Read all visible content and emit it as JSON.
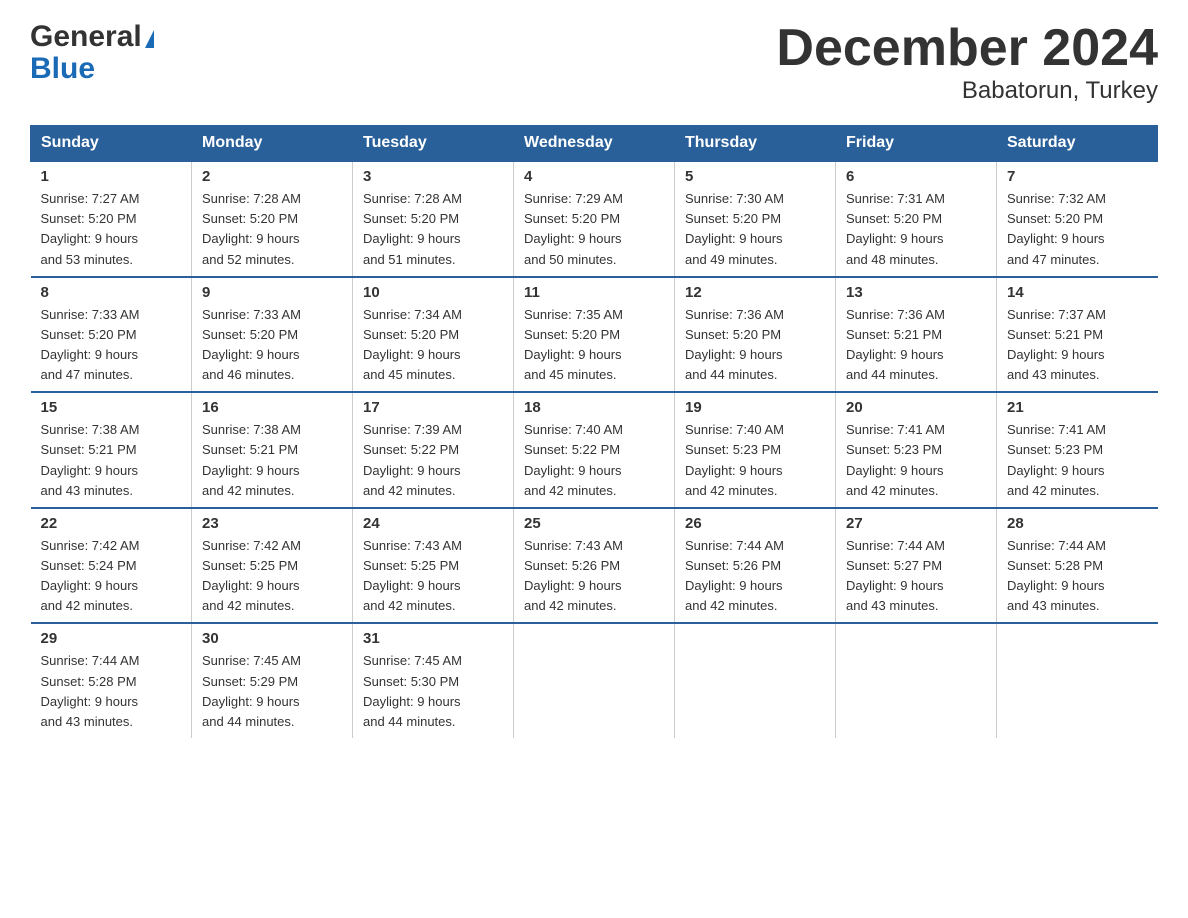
{
  "logo": {
    "line1": "General",
    "triangle": "▶",
    "line2": "Blue"
  },
  "title": "December 2024",
  "subtitle": "Babatorun, Turkey",
  "days_header": [
    "Sunday",
    "Monday",
    "Tuesday",
    "Wednesday",
    "Thursday",
    "Friday",
    "Saturday"
  ],
  "weeks": [
    [
      {
        "day": "1",
        "sunrise": "7:27 AM",
        "sunset": "5:20 PM",
        "daylight": "9 hours and 53 minutes."
      },
      {
        "day": "2",
        "sunrise": "7:28 AM",
        "sunset": "5:20 PM",
        "daylight": "9 hours and 52 minutes."
      },
      {
        "day": "3",
        "sunrise": "7:28 AM",
        "sunset": "5:20 PM",
        "daylight": "9 hours and 51 minutes."
      },
      {
        "day": "4",
        "sunrise": "7:29 AM",
        "sunset": "5:20 PM",
        "daylight": "9 hours and 50 minutes."
      },
      {
        "day": "5",
        "sunrise": "7:30 AM",
        "sunset": "5:20 PM",
        "daylight": "9 hours and 49 minutes."
      },
      {
        "day": "6",
        "sunrise": "7:31 AM",
        "sunset": "5:20 PM",
        "daylight": "9 hours and 48 minutes."
      },
      {
        "day": "7",
        "sunrise": "7:32 AM",
        "sunset": "5:20 PM",
        "daylight": "9 hours and 47 minutes."
      }
    ],
    [
      {
        "day": "8",
        "sunrise": "7:33 AM",
        "sunset": "5:20 PM",
        "daylight": "9 hours and 47 minutes."
      },
      {
        "day": "9",
        "sunrise": "7:33 AM",
        "sunset": "5:20 PM",
        "daylight": "9 hours and 46 minutes."
      },
      {
        "day": "10",
        "sunrise": "7:34 AM",
        "sunset": "5:20 PM",
        "daylight": "9 hours and 45 minutes."
      },
      {
        "day": "11",
        "sunrise": "7:35 AM",
        "sunset": "5:20 PM",
        "daylight": "9 hours and 45 minutes."
      },
      {
        "day": "12",
        "sunrise": "7:36 AM",
        "sunset": "5:20 PM",
        "daylight": "9 hours and 44 minutes."
      },
      {
        "day": "13",
        "sunrise": "7:36 AM",
        "sunset": "5:21 PM",
        "daylight": "9 hours and 44 minutes."
      },
      {
        "day": "14",
        "sunrise": "7:37 AM",
        "sunset": "5:21 PM",
        "daylight": "9 hours and 43 minutes."
      }
    ],
    [
      {
        "day": "15",
        "sunrise": "7:38 AM",
        "sunset": "5:21 PM",
        "daylight": "9 hours and 43 minutes."
      },
      {
        "day": "16",
        "sunrise": "7:38 AM",
        "sunset": "5:21 PM",
        "daylight": "9 hours and 42 minutes."
      },
      {
        "day": "17",
        "sunrise": "7:39 AM",
        "sunset": "5:22 PM",
        "daylight": "9 hours and 42 minutes."
      },
      {
        "day": "18",
        "sunrise": "7:40 AM",
        "sunset": "5:22 PM",
        "daylight": "9 hours and 42 minutes."
      },
      {
        "day": "19",
        "sunrise": "7:40 AM",
        "sunset": "5:23 PM",
        "daylight": "9 hours and 42 minutes."
      },
      {
        "day": "20",
        "sunrise": "7:41 AM",
        "sunset": "5:23 PM",
        "daylight": "9 hours and 42 minutes."
      },
      {
        "day": "21",
        "sunrise": "7:41 AM",
        "sunset": "5:23 PM",
        "daylight": "9 hours and 42 minutes."
      }
    ],
    [
      {
        "day": "22",
        "sunrise": "7:42 AM",
        "sunset": "5:24 PM",
        "daylight": "9 hours and 42 minutes."
      },
      {
        "day": "23",
        "sunrise": "7:42 AM",
        "sunset": "5:25 PM",
        "daylight": "9 hours and 42 minutes."
      },
      {
        "day": "24",
        "sunrise": "7:43 AM",
        "sunset": "5:25 PM",
        "daylight": "9 hours and 42 minutes."
      },
      {
        "day": "25",
        "sunrise": "7:43 AM",
        "sunset": "5:26 PM",
        "daylight": "9 hours and 42 minutes."
      },
      {
        "day": "26",
        "sunrise": "7:44 AM",
        "sunset": "5:26 PM",
        "daylight": "9 hours and 42 minutes."
      },
      {
        "day": "27",
        "sunrise": "7:44 AM",
        "sunset": "5:27 PM",
        "daylight": "9 hours and 43 minutes."
      },
      {
        "day": "28",
        "sunrise": "7:44 AM",
        "sunset": "5:28 PM",
        "daylight": "9 hours and 43 minutes."
      }
    ],
    [
      {
        "day": "29",
        "sunrise": "7:44 AM",
        "sunset": "5:28 PM",
        "daylight": "9 hours and 43 minutes."
      },
      {
        "day": "30",
        "sunrise": "7:45 AM",
        "sunset": "5:29 PM",
        "daylight": "9 hours and 44 minutes."
      },
      {
        "day": "31",
        "sunrise": "7:45 AM",
        "sunset": "5:30 PM",
        "daylight": "9 hours and 44 minutes."
      },
      null,
      null,
      null,
      null
    ]
  ]
}
